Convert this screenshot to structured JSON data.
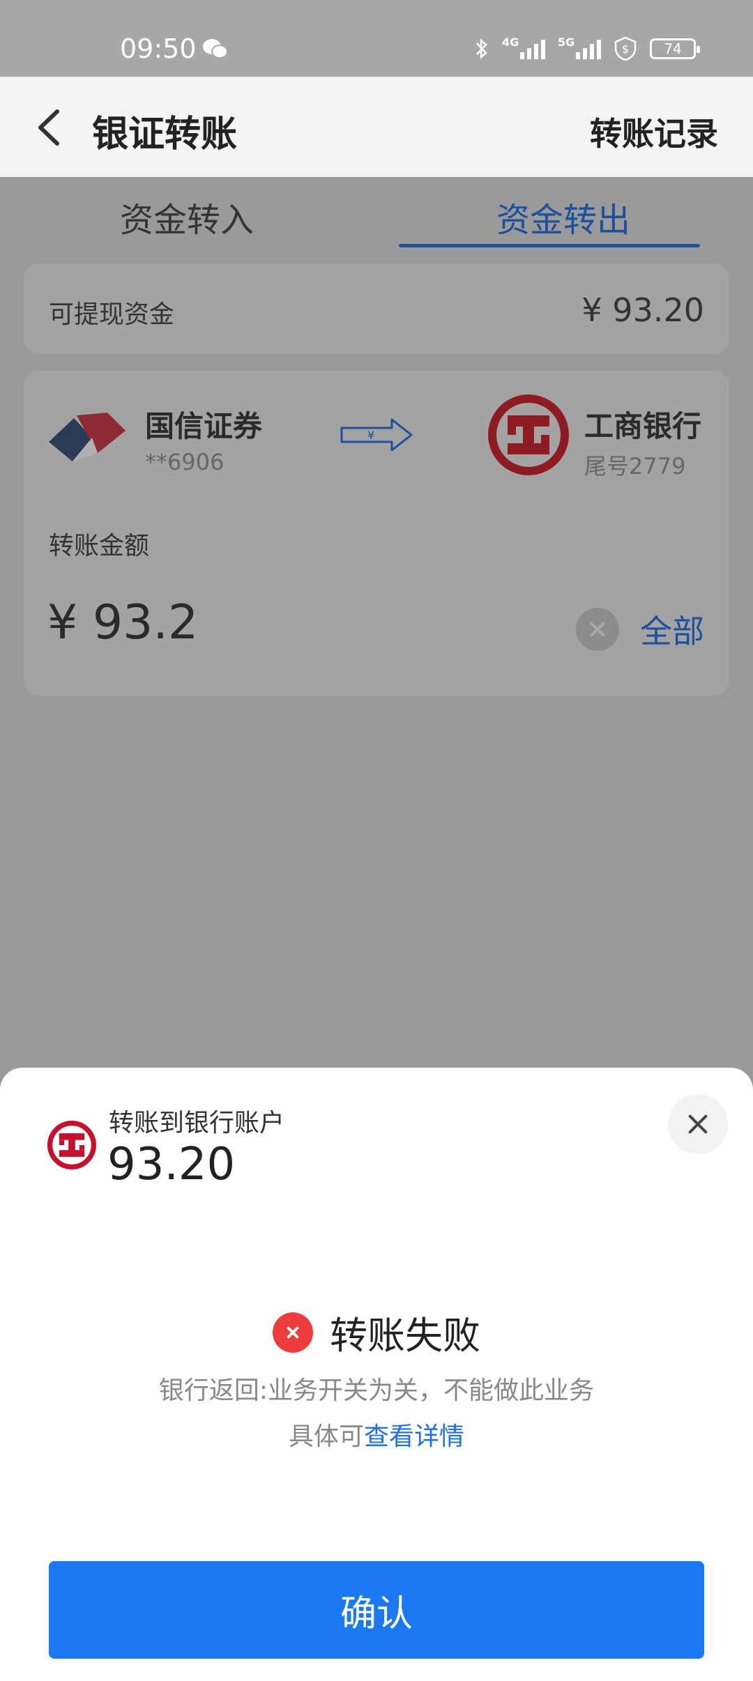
{
  "status_bar": {
    "time": "09:50",
    "network_4g": "4G",
    "network_5g": "5G",
    "battery": "74"
  },
  "header": {
    "title": "银证转账",
    "records": "转账记录"
  },
  "tabs": [
    {
      "label": "资金转入",
      "selected": false
    },
    {
      "label": "资金转出",
      "selected": true
    }
  ],
  "balance": {
    "label": "可提现资金",
    "value": "¥ 93.20"
  },
  "transfer": {
    "from_name": "国信证券",
    "from_account": "**6906",
    "arrow_symbol": "¥",
    "to_name": "工商银行",
    "to_account": "尾号2779",
    "amount_label": "转账金额",
    "amount_value": "¥ 93.2",
    "all_label": "全部"
  },
  "sheet": {
    "title": "转账到银行账户",
    "amount": "93.20",
    "status": "转账失败",
    "reason": "银行返回:业务开关为关，不能做此业务",
    "detail_prefix": "具体可",
    "detail_link": "查看详情",
    "confirm": "确认"
  },
  "colors": {
    "accent_blue": "#1a78f2",
    "tab_blue": "#1d4f9c",
    "error_red": "#ee3b3b",
    "icbc_red": "#c8102e"
  }
}
